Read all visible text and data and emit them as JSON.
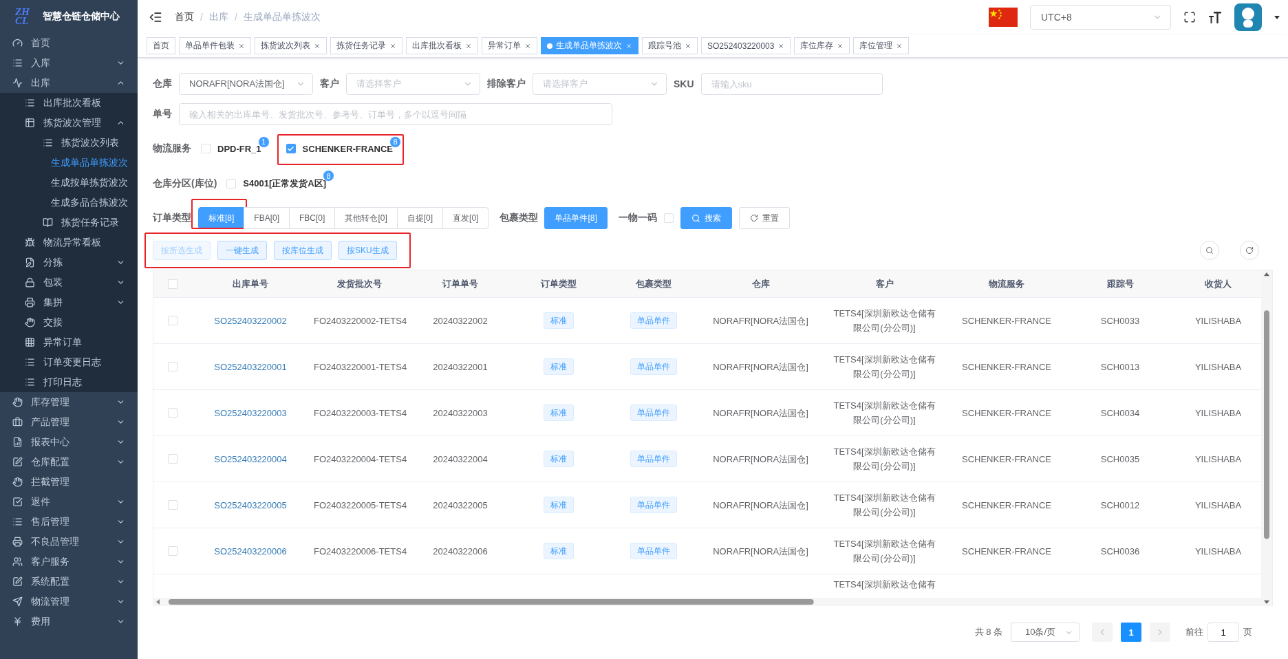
{
  "app": {
    "title": "智慧仓链仓储中心",
    "logo_text": "ZHCL"
  },
  "sidebar": {
    "items": [
      {
        "label": "首页"
      },
      {
        "label": "入库",
        "expanded": false
      },
      {
        "label": "出库",
        "expanded": true,
        "children": [
          {
            "label": "出库批次看板"
          },
          {
            "label": "拣货波次管理",
            "expanded": true,
            "children": [
              {
                "label": "拣货波次列表",
                "selected": false
              },
              {
                "label": "生成单品单拣波次",
                "selected": true
              },
              {
                "label": "生成按单拣货波次",
                "selected": false
              },
              {
                "label": "生成多品合拣波次",
                "selected": false
              },
              {
                "label": "拣货任务记录",
                "selected": false
              }
            ]
          },
          {
            "label": "物流异常看板"
          },
          {
            "label": "分拣",
            "expanded": false
          },
          {
            "label": "包装",
            "expanded": false
          },
          {
            "label": "集拼",
            "expanded": false
          },
          {
            "label": "交接"
          },
          {
            "label": "异常订单"
          },
          {
            "label": "订单变更日志"
          },
          {
            "label": "打印日志"
          }
        ]
      },
      {
        "label": "库存管理",
        "expanded": false
      },
      {
        "label": "产品管理",
        "expanded": false
      },
      {
        "label": "报表中心",
        "expanded": false
      },
      {
        "label": "仓库配置",
        "expanded": false
      },
      {
        "label": "拦截管理"
      },
      {
        "label": "退件",
        "expanded": false
      },
      {
        "label": "售后管理",
        "expanded": false
      },
      {
        "label": "不良品管理",
        "expanded": false
      },
      {
        "label": "客户服务",
        "expanded": false
      },
      {
        "label": "系统配置",
        "expanded": false
      },
      {
        "label": "物流管理",
        "expanded": false
      },
      {
        "label": "费用",
        "expanded": false
      }
    ]
  },
  "header": {
    "breadcrumb": [
      {
        "label": "首页",
        "current": false
      },
      {
        "label": "出库",
        "current": true
      },
      {
        "label": "生成单品单拣波次",
        "current": true
      }
    ],
    "separator": "/",
    "timezone": "UTC+8"
  },
  "tabs": [
    {
      "label": "首页",
      "selected": false,
      "closable": false
    },
    {
      "label": "单品单件包装",
      "selected": false,
      "closable": true
    },
    {
      "label": "拣货波次列表",
      "selected": false,
      "closable": true
    },
    {
      "label": "拣货任务记录",
      "selected": false,
      "closable": true
    },
    {
      "label": "出库批次看板",
      "selected": false,
      "closable": true
    },
    {
      "label": "异常订单",
      "selected": false,
      "closable": true
    },
    {
      "label": "生成单品单拣波次",
      "selected": true,
      "closable": true
    },
    {
      "label": "跟踪号池",
      "selected": false,
      "closable": true
    },
    {
      "label": "SO252403220003",
      "selected": false,
      "closable": true
    },
    {
      "label": "库位库存",
      "selected": false,
      "closable": true
    },
    {
      "label": "库位管理",
      "selected": false,
      "closable": true
    }
  ],
  "filters": {
    "warehouse": {
      "label": "仓库",
      "value": "NORAFR[NORA法国仓]"
    },
    "customer": {
      "label": "客户",
      "placeholder": "请选择客户"
    },
    "exclude_customer": {
      "label": "排除客户",
      "placeholder": "请选择客户"
    },
    "sku": {
      "label": "SKU",
      "placeholder": "请输入sku"
    },
    "order_no": {
      "label": "单号",
      "placeholder": "输入相关的出库单号、发货批次号、参考号、订单号，多个以逗号间隔"
    },
    "logistics": {
      "label": "物流服务",
      "options": [
        {
          "label": "DPD-FR_1",
          "checked": false,
          "count": "1",
          "highlighted": false
        },
        {
          "label": "SCHENKER-FRANCE",
          "checked": true,
          "count": "8",
          "highlighted": true
        }
      ]
    },
    "zone": {
      "label": "仓库分区(库位)",
      "options": [
        {
          "label": "S4001[正常发货A区]",
          "checked": false,
          "count": "8",
          "highlighted": false
        }
      ]
    },
    "order_type": {
      "label": "订单类型",
      "options": [
        {
          "label": "标准[8]",
          "selected": true,
          "highlighted": true
        },
        {
          "label": "FBA[0]",
          "selected": false,
          "highlighted": false
        },
        {
          "label": "FBC[0]",
          "selected": false,
          "highlighted": false
        },
        {
          "label": "其他转仓[0]",
          "selected": false,
          "highlighted": false
        },
        {
          "label": "自提[0]",
          "selected": false,
          "highlighted": false
        },
        {
          "label": "直发[0]",
          "selected": false,
          "highlighted": false
        }
      ]
    },
    "package_type": {
      "label": "包裹类型",
      "options": [
        {
          "label": "单品单件[8]",
          "selected": true
        }
      ]
    },
    "one_code": {
      "label": "一物一码",
      "checked": false
    },
    "search_button": "搜索",
    "reset_button": "重置"
  },
  "actions": {
    "highlighted": true,
    "buttons": [
      {
        "label": "按所选生成",
        "disabled": true
      },
      {
        "label": "一键生成",
        "disabled": false
      },
      {
        "label": "按库位生成",
        "disabled": false
      },
      {
        "label": "按SKU生成",
        "disabled": false
      }
    ]
  },
  "table": {
    "all_checked": false,
    "columns": [
      "出库单号",
      "发货批次号",
      "订单单号",
      "订单类型",
      "包裹类型",
      "仓库",
      "客户",
      "物流服务",
      "跟踪号",
      "收货人"
    ],
    "rows": [
      {
        "kind": "full",
        "checked": false,
        "cells": [
          "SO252403220002",
          "FO2403220002-TETS4",
          "20240322002",
          "标准",
          "单品单件",
          "NORAFR[NORA法国仓]",
          "TETS4[深圳新欧达仓储有限公司(分公司)]",
          "SCHENKER-FRANCE",
          "SCH0033",
          "YILISHABA"
        ]
      },
      {
        "kind": "full",
        "checked": false,
        "cells": [
          "SO252403220001",
          "FO2403220001-TETS4",
          "20240322001",
          "标准",
          "单品单件",
          "NORAFR[NORA法国仓]",
          "TETS4[深圳新欧达仓储有限公司(分公司)]",
          "SCHENKER-FRANCE",
          "SCH0013",
          "YILISHABA"
        ]
      },
      {
        "kind": "full",
        "checked": false,
        "cells": [
          "SO252403220003",
          "FO2403220003-TETS4",
          "20240322003",
          "标准",
          "单品单件",
          "NORAFR[NORA法国仓]",
          "TETS4[深圳新欧达仓储有限公司(分公司)]",
          "SCHENKER-FRANCE",
          "SCH0034",
          "YILISHABA"
        ]
      },
      {
        "kind": "full",
        "checked": false,
        "cells": [
          "SO252403220004",
          "FO2403220004-TETS4",
          "20240322004",
          "标准",
          "单品单件",
          "NORAFR[NORA法国仓]",
          "TETS4[深圳新欧达仓储有限公司(分公司)]",
          "SCHENKER-FRANCE",
          "SCH0035",
          "YILISHABA"
        ]
      },
      {
        "kind": "full",
        "checked": false,
        "cells": [
          "SO252403220005",
          "FO2403220005-TETS4",
          "20240322005",
          "标准",
          "单品单件",
          "NORAFR[NORA法国仓]",
          "TETS4[深圳新欧达仓储有限公司(分公司)]",
          "SCHENKER-FRANCE",
          "SCH0012",
          "YILISHABA"
        ]
      },
      {
        "kind": "full",
        "checked": false,
        "cells": [
          "SO252403220006",
          "FO2403220006-TETS4",
          "20240322006",
          "标准",
          "单品单件",
          "NORAFR[NORA法国仓]",
          "TETS4[深圳新欧达仓储有限公司(分公司)]",
          "SCHENKER-FRANCE",
          "SCH0036",
          "YILISHABA"
        ]
      },
      {
        "kind": "partial",
        "customer": "TETS4[深圳新欧达仓储有"
      }
    ]
  },
  "pagination": {
    "total": "共 8 条",
    "page_size": "10条/页",
    "pages": [
      {
        "label": "1",
        "selected": true
      }
    ],
    "goto_label": "前往",
    "goto_value": "1",
    "goto_suffix": "页"
  }
}
